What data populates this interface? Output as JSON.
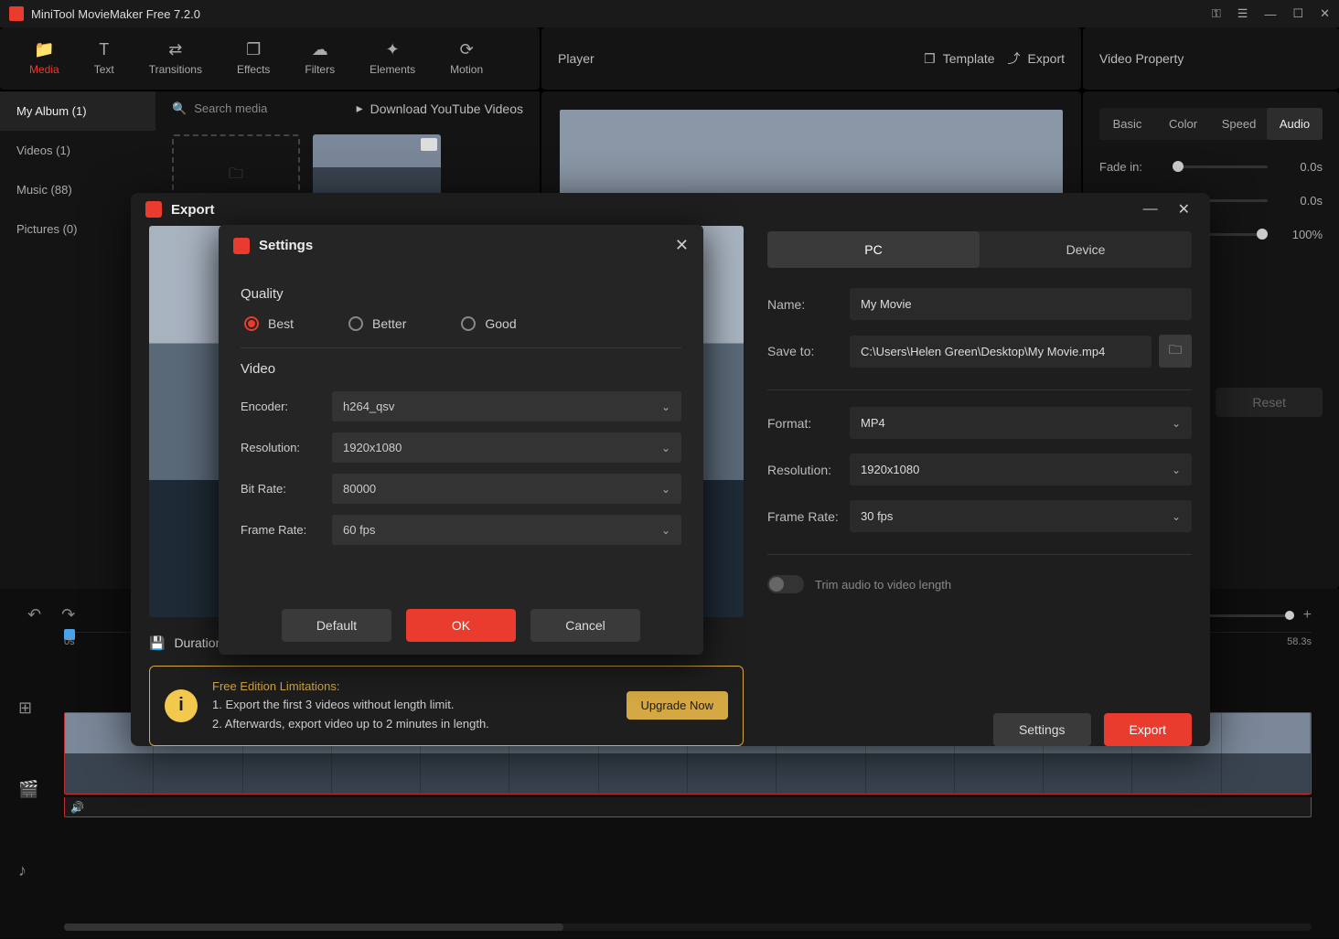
{
  "app": {
    "title": "MiniTool MovieMaker Free 7.2.0"
  },
  "toolbar": {
    "items": [
      {
        "label": "Media"
      },
      {
        "label": "Text"
      },
      {
        "label": "Transitions"
      },
      {
        "label": "Effects"
      },
      {
        "label": "Filters"
      },
      {
        "label": "Elements"
      },
      {
        "label": "Motion"
      }
    ]
  },
  "player": {
    "title": "Player",
    "template": "Template",
    "export": "Export"
  },
  "videoProperty": {
    "title": "Video Property",
    "tabs": [
      "Basic",
      "Color",
      "Speed",
      "Audio"
    ],
    "fadeIn": {
      "label": "Fade in:",
      "value": "0.0s"
    },
    "fadeOut": {
      "value": "0.0s"
    },
    "percent": "100%",
    "reset": "Reset"
  },
  "sidebar": {
    "items": [
      {
        "label": "My Album (1)"
      },
      {
        "label": "Videos (1)"
      },
      {
        "label": "Music (88)"
      },
      {
        "label": "Pictures (0)"
      }
    ],
    "searchPlaceholder": "Search media",
    "downloadLabel": "Download YouTube Videos"
  },
  "timeline": {
    "start": "0s",
    "end": "58.3s"
  },
  "exportDialog": {
    "title": "Export",
    "duration": "Duration",
    "limitations": {
      "heading": "Free Edition Limitations:",
      "line1": "1. Export the first 3 videos without length limit.",
      "line2": "2. Afterwards, export video up to 2 minutes in length.",
      "upgrade": "Upgrade Now"
    },
    "tabs": {
      "pc": "PC",
      "device": "Device"
    },
    "fields": {
      "nameLabel": "Name:",
      "name": "My Movie",
      "saveToLabel": "Save to:",
      "saveTo": "C:\\Users\\Helen Green\\Desktop\\My Movie.mp4",
      "formatLabel": "Format:",
      "format": "MP4",
      "resolutionLabel": "Resolution:",
      "resolution": "1920x1080",
      "frameRateLabel": "Frame Rate:",
      "frameRate": "30 fps",
      "trimLabel": "Trim audio to video length"
    },
    "buttons": {
      "settings": "Settings",
      "export": "Export"
    }
  },
  "settingsDialog": {
    "title": "Settings",
    "quality": {
      "heading": "Quality",
      "best": "Best",
      "better": "Better",
      "good": "Good"
    },
    "video": {
      "heading": "Video",
      "encoderLabel": "Encoder:",
      "encoder": "h264_qsv",
      "resolutionLabel": "Resolution:",
      "resolution": "1920x1080",
      "bitRateLabel": "Bit Rate:",
      "bitRate": "80000",
      "frameRateLabel": "Frame Rate:",
      "frameRate": "60 fps"
    },
    "buttons": {
      "default": "Default",
      "ok": "OK",
      "cancel": "Cancel"
    }
  }
}
